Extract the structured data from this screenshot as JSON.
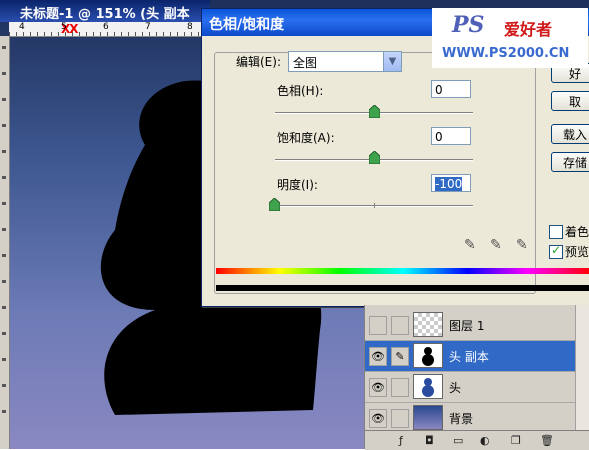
{
  "document": {
    "title": "未标题-1 @ 151% (头 副本",
    "ruler_numbers": [
      "4",
      "5",
      "6",
      "7",
      "8"
    ],
    "ruler_marks": "XX"
  },
  "dialog": {
    "title": "色相/饱和度",
    "edit_label": "编辑(E):",
    "edit_value": "全图",
    "hue_label": "色相(H):",
    "hue_value": "0",
    "saturation_label": "饱和度(A):",
    "saturation_value": "0",
    "lightness_label": "明度(I):",
    "lightness_value": "-100",
    "hue_level": 0,
    "saturation_level": 0,
    "lightness_level": -100,
    "ok_label": "好",
    "cancel_label": "取",
    "load_label": "载入",
    "save_label": "存储",
    "colorize_label": "着色",
    "colorize_checked": false,
    "preview_label": "预览",
    "preview_checked": true
  },
  "watermark": {
    "logo": "PS",
    "tagline": "爱好者",
    "url": "WWW.PS2000.CN"
  },
  "layers": {
    "rows": [
      {
        "name": "图层 1",
        "visible": false,
        "selected": false,
        "thumb": "checker"
      },
      {
        "name": "头 副本",
        "visible": true,
        "selected": true,
        "thumb": "shape"
      },
      {
        "name": "头",
        "visible": true,
        "selected": false,
        "thumb": "shape-blue"
      },
      {
        "name": "背景",
        "visible": true,
        "selected": false,
        "thumb": "gradient"
      }
    ]
  },
  "colors": {
    "titlebar_blue": "#0a54d8",
    "selection_blue": "#3169c6",
    "canvas_top": "#1d2f5a",
    "canvas_bottom": "#8a88c2",
    "silhouette": "#000000"
  }
}
